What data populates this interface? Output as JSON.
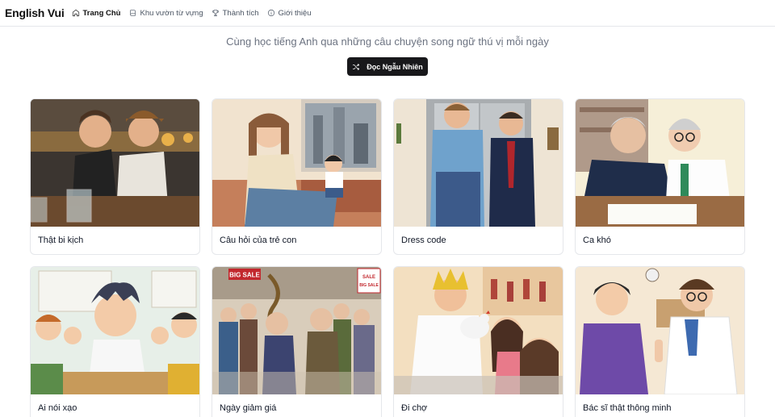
{
  "nav": {
    "brand": "English Vui",
    "items": [
      {
        "label": "Trang Chủ",
        "icon": "home-icon",
        "active": true
      },
      {
        "label": "Khu vườn từ vựng",
        "icon": "book-icon",
        "active": false
      },
      {
        "label": "Thành tích",
        "icon": "trophy-icon",
        "active": false
      },
      {
        "label": "Giới thiệu",
        "icon": "info-icon",
        "active": false
      }
    ]
  },
  "hero": {
    "subtitle": "Cùng học tiếng Anh qua những câu chuyện song ngữ thú vị mỗi ngày",
    "random_button": "Đọc Ngẫu Nhiên",
    "random_icon": "shuffle-icon"
  },
  "stories": [
    {
      "title": "Thật bi kịch",
      "image": "two-men-at-bar-illustration"
    },
    {
      "title": "Câu hỏi của trẻ con",
      "image": "mother-and-child-on-couch-illustration"
    },
    {
      "title": "Dress code",
      "image": "two-men-at-elevator-illustration"
    },
    {
      "title": "Ca khó",
      "image": "old-man-and-doctor-illustration"
    },
    {
      "title": "Ai nói xạo",
      "image": "classroom-kids-illustration"
    },
    {
      "title": "Ngày giảm giá",
      "image": "sale-crowd-illustration",
      "sign_text": [
        "BIG SALE",
        "SALE",
        "BIG SALE"
      ]
    },
    {
      "title": "Đi chợ",
      "image": "man-with-chicken-at-market-illustration"
    },
    {
      "title": "Bác sĩ thật thông minh",
      "image": "patient-and-doctor-illustration"
    }
  ],
  "colors": {
    "button_bg": "#18181b",
    "border": "#e5e7eb",
    "muted_text": "#6b7280"
  }
}
